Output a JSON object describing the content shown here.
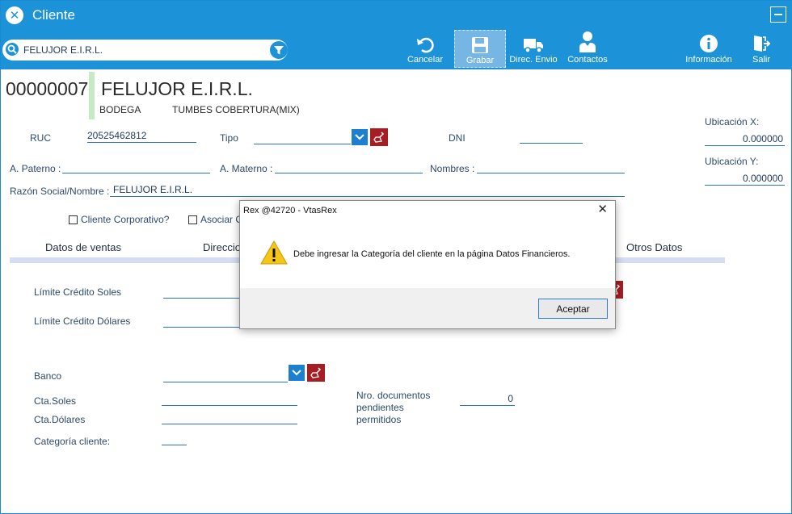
{
  "window": {
    "title": "Cliente"
  },
  "search": {
    "value": "FELUJOR E.I.R.L."
  },
  "toolbar": {
    "cancel": "Cancelar",
    "save": "Grabar",
    "shipping": "Direc. Envio",
    "contacts": "Contactos",
    "info": "Información",
    "exit": "Salir"
  },
  "client": {
    "code": "00000007",
    "name": "FELUJOR E.I.R.L.",
    "type_label": "BODEGA",
    "coverage": "TUMBES COBERTURA(MIX)"
  },
  "form": {
    "ruc_label": "RUC",
    "ruc_value": "20525462812",
    "tipo_label": "Tipo",
    "dni_label": "DNI",
    "ubic_x_label": "Ubicación X:",
    "ubic_x_value": "0.000000",
    "ubic_y_label": "Ubicación Y:",
    "ubic_y_value": "0.000000",
    "paterno_label": "A. Paterno :",
    "materno_label": "A. Materno :",
    "nombres_label": "Nombres :",
    "razon_label": "Razón Social/Nombre :",
    "razon_value": "FELUJOR E.I.R.L.",
    "corporativo_label": "Cliente Corporativo?",
    "asociar_label": "Asociar C"
  },
  "tabs": [
    "Datos de ventas",
    "Direccio",
    "Otros Datos"
  ],
  "sales": {
    "credito_soles_label": "Límite Crédito Soles",
    "credito_dolares_label": "Límite Crédito Dólares",
    "banco_label": "Banco",
    "cta_soles_label": "Cta.Soles",
    "cta_dolares_label": "Cta.Dólares",
    "categoria_label": "Categoría cliente:",
    "docs_label_1": "Nro. documentos",
    "docs_label_2": "pendientes",
    "docs_label_3": "permitidos",
    "docs_value": "0"
  },
  "dialog": {
    "title": "Rex @42720 - VtasRex",
    "message": "Debe ingresar la Categoría del cliente en la página Datos Financieros.",
    "ok": "Aceptar"
  },
  "colors": {
    "primary": "#1c93d9",
    "clear": "#a61d24",
    "tab_strip": "#d4ddf2"
  }
}
